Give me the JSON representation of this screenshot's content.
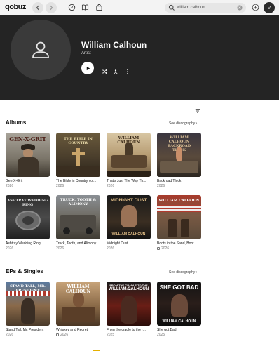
{
  "topbar": {
    "logo": "qobuz",
    "search_value": "william  calhoun",
    "avatar_letter": "V"
  },
  "artist": {
    "name": "William Calhoun",
    "role": "Artist"
  },
  "albums": {
    "title": "Albums",
    "see_all": "See discography",
    "items": [
      {
        "title": "Gen-X-Grit",
        "year": "2026",
        "cover_text": "GEN-X-GRIT",
        "hires": false
      },
      {
        "title": "The Bible in Country vol...",
        "year": "2026",
        "cover_text": "THE BIBLE IN COUNTRY",
        "hires": false
      },
      {
        "title": "That's Just The Way Th...",
        "year": "2026",
        "cover_text": "WILLIAM CALHOUN",
        "hires": false
      },
      {
        "title": "Backroad Thick",
        "year": "2026",
        "cover_text": "WILLIAM CALHOUN BACKROAD THICK",
        "hires": false
      },
      {
        "title": "Ashtray Wedding Ring",
        "year": "2026",
        "cover_text": "ASHTRAY WEDDING RING",
        "hires": false
      },
      {
        "title": "Truck, Tooth, and Alimony",
        "year": "2026",
        "cover_text": "TRUCK, TOOTH & ALIMONY",
        "hires": false
      },
      {
        "title": "Midnight Dust",
        "year": "2026",
        "cover_text": "MIDNIGHT DUST",
        "cover_text2": "WILLIAM CALHOUN",
        "hires": false
      },
      {
        "title": "Boots in the Sand, Boot...",
        "year": "2026",
        "cover_text": "WILLIAM CALHOUN",
        "hires": true
      }
    ]
  },
  "eps": {
    "title": "EPs & Singles",
    "see_all": "See discography",
    "items": [
      {
        "title": "Stand Tall, Mr. President",
        "year": "2026",
        "cover_text": "STAND TALL, MR. PRESIDENT",
        "hires": false
      },
      {
        "title": "Whiskey and Regret",
        "year": "2026",
        "cover_text": "WILLIAM CALHOUN",
        "hires": true
      },
      {
        "title": "From the cradle to the r...",
        "year": "2025",
        "cover_text": "FROM THE CRADLE TO THE ROAD",
        "cover_text2": "WILLIAM CALHOUN",
        "hires": false
      },
      {
        "title": "She got Bad",
        "year": "2025",
        "cover_text": "SHE GOT BAD",
        "cover_text2": "WILLIAM CALHOUN",
        "hires": false
      }
    ]
  },
  "colors": {
    "hero_bg": "#242424",
    "badge": "#e5b000"
  }
}
